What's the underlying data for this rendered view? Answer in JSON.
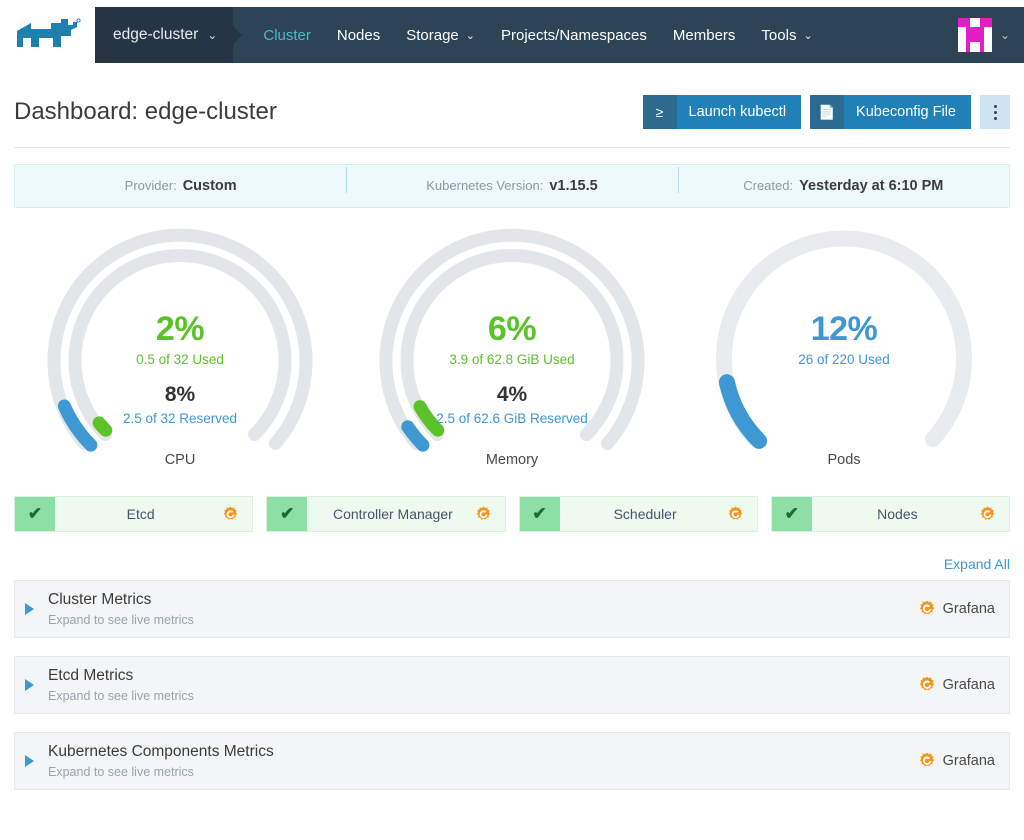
{
  "nav": {
    "logo_icon": "rancher-cow-logo",
    "cluster_selector": "edge-cluster",
    "cluster_selector_chevron": "⌄",
    "items": [
      {
        "label": "Cluster",
        "active": true,
        "chevron": ""
      },
      {
        "label": "Nodes",
        "active": false,
        "chevron": ""
      },
      {
        "label": "Storage",
        "active": false,
        "chevron": "⌄"
      },
      {
        "label": "Projects/Namespaces",
        "active": false,
        "chevron": ""
      },
      {
        "label": "Members",
        "active": false,
        "chevron": ""
      },
      {
        "label": "Tools",
        "active": false,
        "chevron": "⌄"
      }
    ],
    "avatar_icon": "user-avatar",
    "avatar_chevron": "⌄"
  },
  "header": {
    "title": "Dashboard: edge-cluster",
    "launch_kubectl": {
      "icon": "≥",
      "label": "Launch kubectl"
    },
    "kubeconfig": {
      "icon": "📄",
      "label": "Kubeconfig File"
    },
    "kebab_label": "more-actions"
  },
  "banner": [
    {
      "key": "Provider:",
      "value": "Custom"
    },
    {
      "key": "Kubernetes Version:",
      "value": "v1.15.5"
    },
    {
      "key": "Created:",
      "value": "Yesterday at 6:10 PM"
    }
  ],
  "gauges": [
    {
      "name": "CPU",
      "used_pct": "2%",
      "used_sub": "0.5 of 32 Used",
      "reserved_pct": "8%",
      "reserved_sub": "2.5 of 32 Reserved",
      "used_value": 2,
      "reserved_value": 8,
      "dual": true,
      "used_color": "#5ac328",
      "reserved_color": "#3d98d3",
      "track_color": "#e3e6e8"
    },
    {
      "name": "Memory",
      "used_pct": "6%",
      "used_sub": "3.9 of 62.8 GiB Used",
      "reserved_pct": "4%",
      "reserved_sub": "2.5 of 62.6 GiB Reserved",
      "used_value": 6,
      "reserved_value": 4,
      "dual": true,
      "used_color": "#5ac328",
      "reserved_color": "#3d98d3",
      "track_color": "#e3e6e8"
    },
    {
      "name": "Pods",
      "used_pct": "12%",
      "used_sub": "26 of 220 Used",
      "reserved_pct": "",
      "reserved_sub": "",
      "used_value": 12,
      "reserved_value": 0,
      "dual": false,
      "used_color": "#3d98d3",
      "reserved_color": "#3d98d3",
      "track_color": "#e3e6e8"
    }
  ],
  "status": [
    {
      "name": "Etcd",
      "check": "✔",
      "grafana_icon": "grafana-icon"
    },
    {
      "name": "Controller Manager",
      "check": "✔",
      "grafana_icon": "grafana-icon"
    },
    {
      "name": "Scheduler",
      "check": "✔",
      "grafana_icon": "grafana-icon"
    },
    {
      "name": "Nodes",
      "check": "✔",
      "grafana_icon": "grafana-icon"
    }
  ],
  "expand_all": "Expand All",
  "accordions": [
    {
      "title": "Cluster Metrics",
      "subtitle": "Expand to see live metrics",
      "link": "Grafana"
    },
    {
      "title": "Etcd Metrics",
      "subtitle": "Expand to see live metrics",
      "link": "Grafana"
    },
    {
      "title": "Kubernetes Components Metrics",
      "subtitle": "Expand to see live metrics",
      "link": "Grafana"
    }
  ],
  "colors": {
    "nav_bg": "#2d4456",
    "nav_active": "#4bb9c9",
    "accent_blue": "#3d98d3",
    "used_green": "#5ac328",
    "button_blue": "#1f81b8",
    "grafana_orange": "#f7941e"
  }
}
